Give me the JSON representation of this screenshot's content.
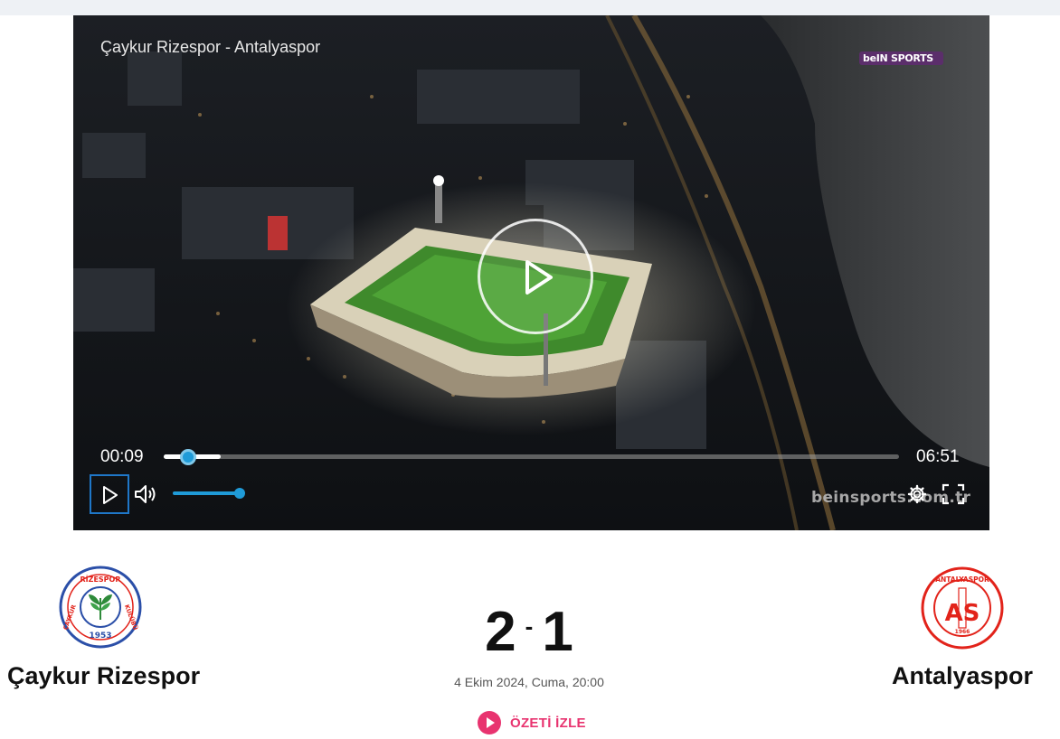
{
  "video": {
    "title": "Çaykur Rizespor - Antalyaspor",
    "brand_badge": "beIN SPORTS",
    "watermark": "beinsports.com.tr",
    "current_time": "00:09",
    "duration": "06:51",
    "progress_fraction": 0.022,
    "buffered_fraction": 0.077,
    "volume_fraction": 1.0,
    "accent_color": "#1f9bd8",
    "icons": [
      "play-icon",
      "volume-icon",
      "settings-icon",
      "fullscreen-icon"
    ]
  },
  "match": {
    "home_team": "Çaykur Rizespor",
    "home_logo": {
      "top_text": "RİZESPOR",
      "left_text": "ÇAYKUR",
      "right_text": "KULÜBÜ",
      "year": "1953",
      "color": "#2b4fa8"
    },
    "away_team": "Antalyaspor",
    "away_logo": {
      "top_text": "ANTALYASPOR",
      "monogram": "AS",
      "year": "1966",
      "color": "#e2231a"
    },
    "home_score": "2",
    "separator": "-",
    "away_score": "1",
    "date": "4 Ekim 2024, Cuma, 20:00",
    "summary_label": "ÖZETİ İZLE",
    "summary_color": "#e8336f"
  }
}
